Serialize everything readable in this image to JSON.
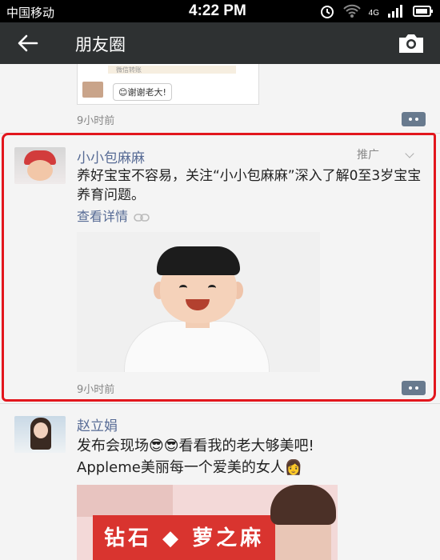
{
  "statusbar": {
    "carrier": "中国移动",
    "time": "4:22 PM",
    "network": "4G"
  },
  "header": {
    "title": "朋友圈",
    "back_icon": "back-arrow-icon",
    "camera_icon": "camera-icon"
  },
  "previous_post": {
    "card_text": "微信转账",
    "reply": "😊谢谢老大!",
    "time": "9小时前"
  },
  "ad_post": {
    "name": "小小包麻麻",
    "promo_label": "推广",
    "text": "养好宝宝不容易，关注“小小包麻麻”深入了解0至3岁宝宝养育问题。",
    "link_label": "查看详情",
    "time": "9小时前"
  },
  "next_post": {
    "name": "赵立娟",
    "line1": "发布会现场😎😎看看我的老大够美吧!",
    "line2": "Appleme美丽每一个爱美的女人👩",
    "photo_banner_text": "钻石 ◆ 萝之麻"
  },
  "colors": {
    "accent_name": "#576b95",
    "highlight": "#e2161d",
    "titlebar": "#2e3132"
  }
}
